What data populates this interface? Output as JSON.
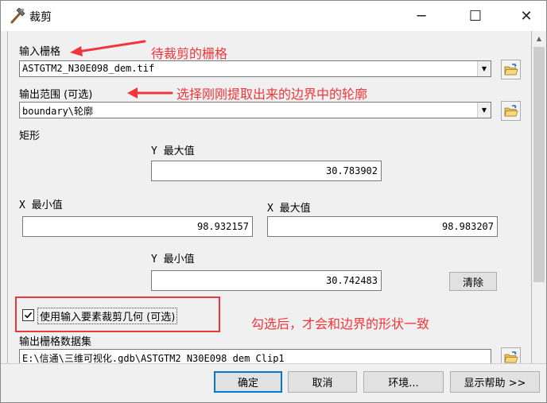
{
  "window": {
    "title": "裁剪",
    "minimize_glyph": "─",
    "maximize_glyph": "☐",
    "close_glyph": "✕"
  },
  "input_raster": {
    "label": "输入栅格",
    "value": "ASTGTM2_N30E098_dem.tif"
  },
  "output_extent": {
    "label": "输出范围 (可选)",
    "value": "boundary\\轮廓"
  },
  "rectangle": {
    "label": "矩形",
    "y_max_label": "Y 最大值",
    "y_max": "30.783902",
    "x_min_label": "X 最小值",
    "x_min": "98.932157",
    "x_max_label": "X 最大值",
    "x_max": "98.983207",
    "y_min_label": "Y 最小值",
    "y_min": "30.742483",
    "clear_label": "清除"
  },
  "clip_geometry": {
    "label": "使用输入要素裁剪几何 (可选)",
    "checked": true
  },
  "output_raster": {
    "label": "输出栅格数据集",
    "value": "E:\\信通\\三维可视化.gdb\\ASTGTM2_N30E098_dem_Clip1"
  },
  "buttons": {
    "ok": "确定",
    "cancel": "取消",
    "environments": "环境...",
    "show_help": "显示帮助 >>"
  },
  "annotations": {
    "raster_note": "待裁剪的栅格",
    "extent_note": "选择刚刚提取出来的边界中的轮廓",
    "checkbox_note": "勾选后，才会和边界的形状一致"
  },
  "colors": {
    "annotation": "#f2353a",
    "highlight_box": "#e8393e",
    "default_button_border": "#0078d7"
  },
  "icons": {
    "title": "hammer-icon",
    "browse": "open-folder-icon",
    "dropdown": "chevron-down-icon",
    "checkbox": "checkmark-icon"
  }
}
